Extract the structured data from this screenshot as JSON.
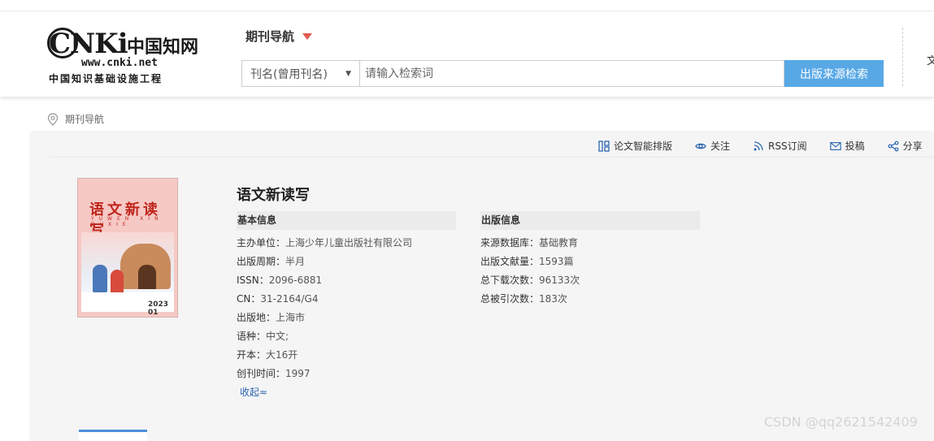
{
  "logo": {
    "brand": "CNKi",
    "brand_cn": "中国知网",
    "url": "www.cnki.net",
    "slogan": "中国知识基础设施工程"
  },
  "header": {
    "nav_title": "期刊导航",
    "search_field_select": "刊名(曾用刊名)",
    "search_placeholder": "请输入检索词",
    "search_button": "出版来源检索",
    "edge_text": "文"
  },
  "breadcrumb": {
    "label": "期刊导航"
  },
  "toolbar": {
    "smart_sort": "论文智能排版",
    "follow": "关注",
    "rss": "RSS订阅",
    "submit": "投稿",
    "share": "分享"
  },
  "cover": {
    "title": "语文新读写",
    "pinyin": "YUWEN XIN DUXIE",
    "issue": "2023 01"
  },
  "journal": {
    "title": "语文新读写",
    "basic_heading": "基本信息",
    "publish_heading": "出版信息",
    "basic": [
      {
        "label": "主办单位：",
        "value": "上海少年儿童出版社有限公司"
      },
      {
        "label": "出版周期：",
        "value": "半月"
      },
      {
        "label": "ISSN：",
        "value": "2096-6881"
      },
      {
        "label": "CN：",
        "value": "31-2164/G4"
      },
      {
        "label": "出版地：",
        "value": "上海市"
      },
      {
        "label": "语种：",
        "value": "中文;"
      },
      {
        "label": "开本：",
        "value": "大16开"
      },
      {
        "label": "创刊时间：",
        "value": "1997"
      }
    ],
    "publish": [
      {
        "label": "来源数据库：",
        "value": "基础教育"
      },
      {
        "label": "出版文献量：",
        "value": "1593篇"
      },
      {
        "label": "总下载次数：",
        "value": "96133次"
      },
      {
        "label": "总被引次数：",
        "value": "183次"
      }
    ],
    "collapse_label": "收起≈"
  },
  "watermark": "CSDN @qq2621542409",
  "colors": {
    "accent_blue": "#58a8e6",
    "nav_triangle": "#e05a4f",
    "cover_red": "#c0251c",
    "link_blue": "#2a65b0"
  }
}
